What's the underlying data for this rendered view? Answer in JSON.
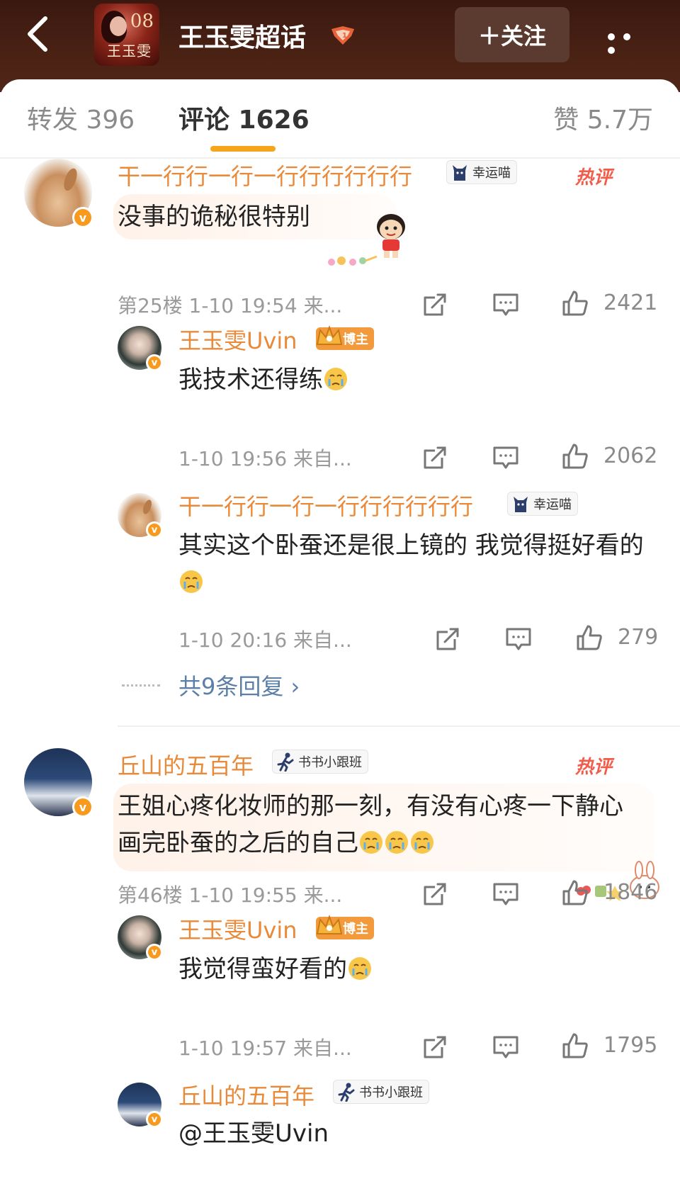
{
  "header": {
    "title": "王玉雯超话",
    "follow_label": "＋关注",
    "cover_text_top": "08",
    "cover_text_bottom": "王玉雯"
  },
  "tabs": {
    "repost": "转发 396",
    "comment": "评论 1626",
    "like": "赞 5.7万"
  },
  "colors": {
    "accent": "#f7a51c",
    "username": "#e98a3a",
    "hot": "#f25c4a",
    "link": "#5c7fa8"
  },
  "hot_label": "热评",
  "comments": [
    {
      "user": "干一行行一行一行行行行行行",
      "tag": "幸运喵",
      "text": "没事的诡秘很特别",
      "floor_meta": "第25楼 1-10 19:54 来...",
      "likes": "2421",
      "replies": [
        {
          "user": "王玉雯Uvin",
          "tag": "博主",
          "text": "我技术还得练",
          "meta": "1-10 19:56 来自...",
          "likes": "2062"
        },
        {
          "user": "干一行行一行一行行行行行行",
          "tag": "幸运喵",
          "text": "其实这个卧蚕还是很上镜的 我觉得挺好看的",
          "meta": "1-10 20:16 来自...",
          "likes": "279"
        }
      ],
      "more_replies": "共9条回复 ›"
    },
    {
      "user": "丘山的五百年",
      "tag": "书书小跟班",
      "text": "王姐心疼化妆师的那一刻，有没有心疼一下静心画完卧蚕的之后的自己",
      "floor_meta": "第46楼 1-10 19:55 来...",
      "likes": "1846",
      "replies": [
        {
          "user": "王玉雯Uvin",
          "tag": "博主",
          "text": "我觉得蛮好看的",
          "meta": "1-10 19:57 来自...",
          "likes": "1795"
        },
        {
          "user": "丘山的五百年",
          "tag": "书书小跟班",
          "text": "@王玉雯Uvin"
        }
      ]
    }
  ]
}
